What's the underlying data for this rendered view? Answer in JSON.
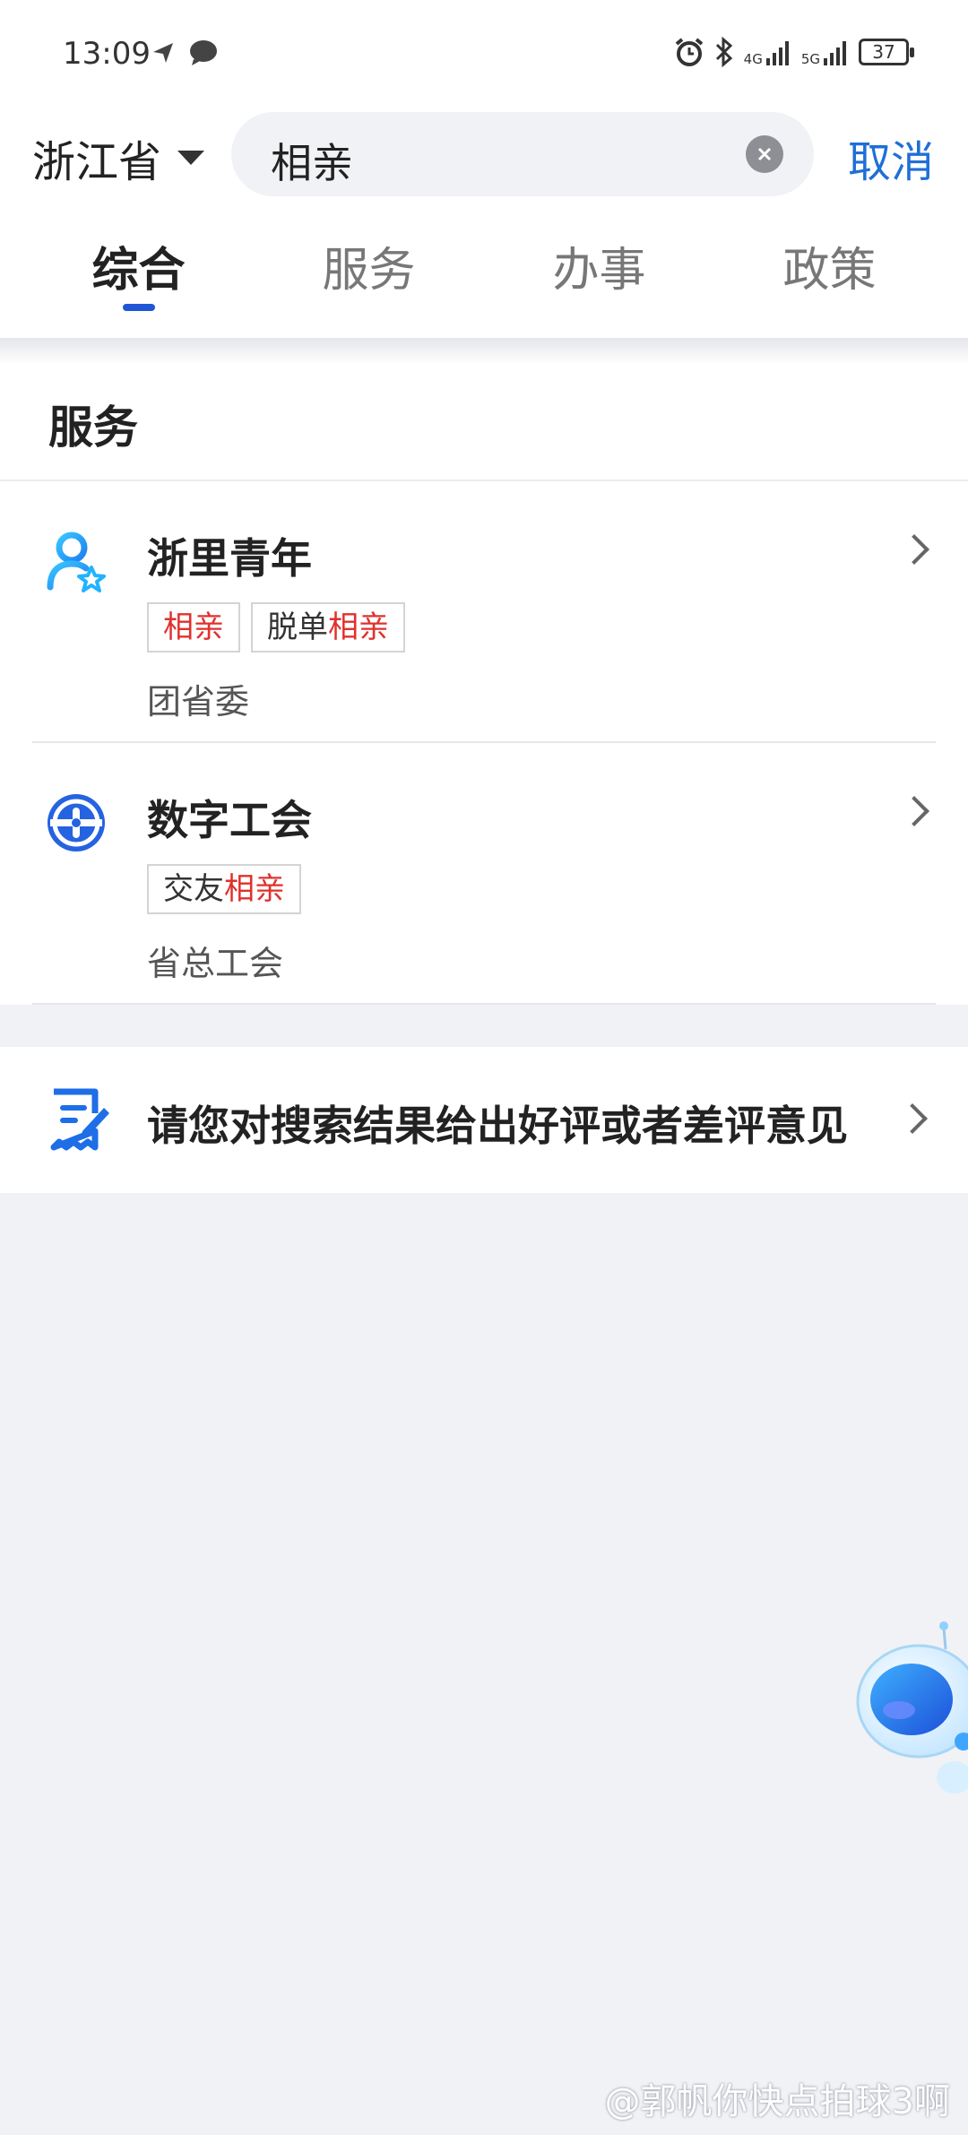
{
  "status_bar": {
    "time": "13:09",
    "battery": "37",
    "net1": "4G",
    "net2": "5G"
  },
  "search": {
    "province": "浙江省",
    "query": "相亲",
    "cancel_label": "取消"
  },
  "tabs": [
    {
      "label": "综合",
      "active": true
    },
    {
      "label": "服务",
      "active": false
    },
    {
      "label": "办事",
      "active": false
    },
    {
      "label": "政策",
      "active": false
    }
  ],
  "services": {
    "title": "服务",
    "items": [
      {
        "name": "浙里青年",
        "tags": [
          {
            "prefix": "",
            "highlight": "相亲"
          },
          {
            "prefix": "脱单",
            "highlight": "相亲"
          }
        ],
        "org": "团省委"
      },
      {
        "name": "数字工会",
        "tags": [
          {
            "prefix": "交友",
            "highlight": "相亲"
          }
        ],
        "org": "省总工会"
      }
    ]
  },
  "feedback": {
    "text": "请您对搜索结果给出好评或者差评意见"
  },
  "watermark": "@郭帆你快点拍球3啊",
  "colors": {
    "accent": "#1f6fd6",
    "highlight": "#e0312e",
    "tab_indicator": "#1f55d6"
  }
}
